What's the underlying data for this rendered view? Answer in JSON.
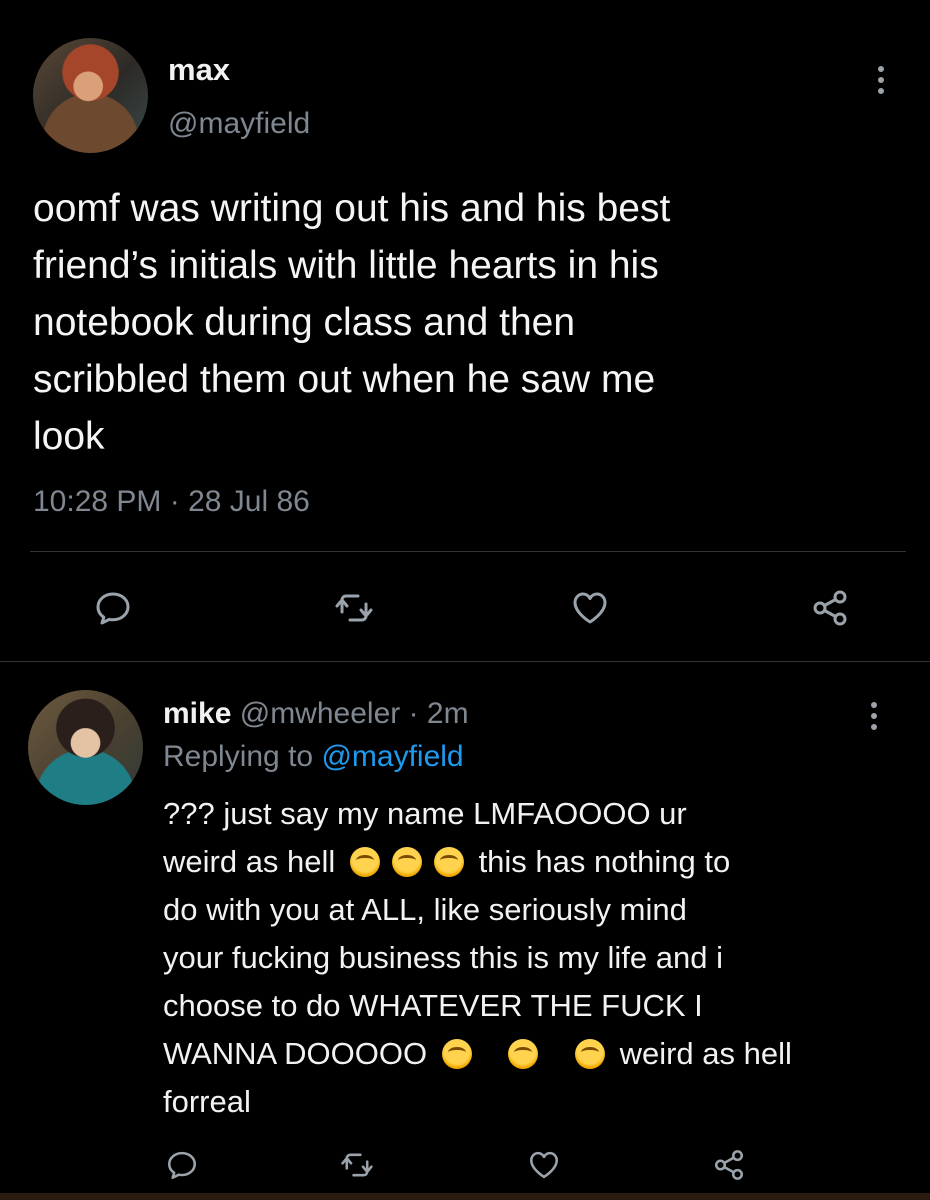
{
  "tweet": {
    "display_name": "max",
    "handle": "@mayfield",
    "lines": [
      "oomf was writing out his and his best",
      "friend’s initials with little hearts in his",
      "notebook during class and then",
      "scribbled them out when he saw me",
      "look"
    ],
    "timestamp": "10:28 PM · 28 Jul 86",
    "actions": [
      "reply-icon",
      "retweet-icon",
      "like-icon",
      "share-icon"
    ]
  },
  "reply": {
    "display_name": "mike",
    "handle": "@mwheeler",
    "time": "· 2m",
    "replying_label": "Replying to",
    "replying_to": "@mayfield",
    "text": {
      "line1": "??? just say my name LMFAOOOO ur",
      "line2a": "weird as hell",
      "line2b": "this has nothing to",
      "line3": "do with you at ALL, like seriously mind",
      "line4": "your fucking business this is my life and i",
      "line5": "choose to do WHATEVER THE FUCK I",
      "line6a": "WANNA DOOOOO",
      "line6b": "weird as hell",
      "line7": "forreal"
    },
    "emoji": "loudly-crying-face",
    "actions": [
      "reply-icon",
      "retweet-icon",
      "like-icon",
      "share-icon"
    ]
  },
  "colors": {
    "background": "#000000",
    "text": "#f5f5f5",
    "secondary": "#7f8790",
    "link": "#1d9bf0",
    "divider": "#2f3336"
  }
}
